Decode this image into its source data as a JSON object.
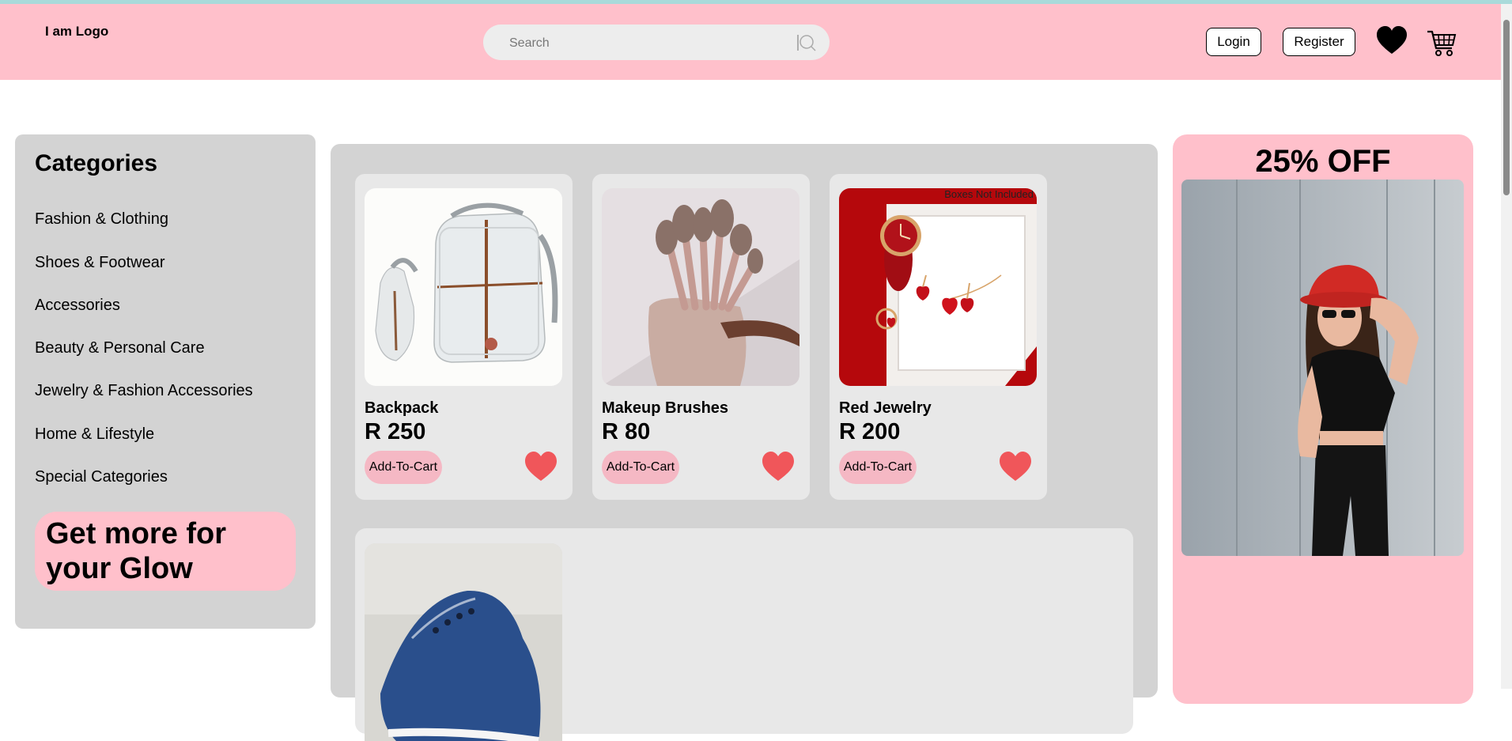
{
  "header": {
    "logo": "I am Logo",
    "search_placeholder": "Search",
    "login": "Login",
    "register": "Register"
  },
  "sidebar": {
    "title": "Categories",
    "categories": [
      "Fashion & Clothing",
      "Shoes & Footwear",
      "Accessories",
      "Beauty & Personal Care",
      "Jewelry & Fashion Accessories",
      "Home & Lifestyle",
      "Special Categories"
    ],
    "promo": "Get more for your Glow"
  },
  "products": [
    {
      "name": "Backpack",
      "price": "R 250",
      "button": "Add-To-Cart"
    },
    {
      "name": "Makeup Brushes",
      "price": "R 80",
      "button": "Add-To-Cart"
    },
    {
      "name": "Red Jewelry",
      "price": "R 200",
      "button": "Add-To-Cart",
      "image_note": "Boxes Not Included"
    }
  ],
  "promo": {
    "title": "25% OFF"
  },
  "colors": {
    "header_bg": "#ffc0cb",
    "panel_bg": "#d3d3d3",
    "card_bg": "#e8e8e8",
    "heart": "#f0565a",
    "button_pink": "#f5b8c4"
  }
}
